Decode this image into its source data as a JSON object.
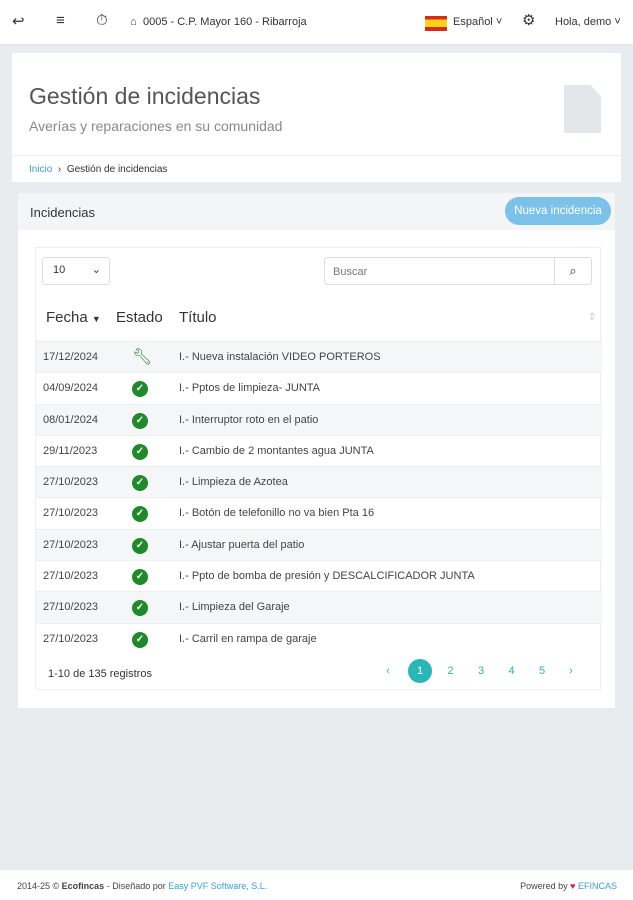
{
  "topbar": {
    "location": "0005 - C.P. Mayor 160 - Ribarroja",
    "language": "Español",
    "user": "Hola, demo"
  },
  "header": {
    "title": "Gestión de incidencias",
    "subtitle": "Averías y reparaciones en su comunidad",
    "breadcrumb": [
      "Inicio",
      "Gestión de incidencias"
    ]
  },
  "panel": {
    "title": "Incidencias",
    "new_button": "Nueva incidencia",
    "page_size": "10",
    "search_placeholder": "Buscar",
    "columns": [
      "Fecha",
      "Estado",
      "Título"
    ],
    "rows": [
      {
        "date": "17/12/2024",
        "status": "in-progress",
        "title": "I.- Nueva instalación VIDEO PORTEROS"
      },
      {
        "date": "04/09/2024",
        "status": "done",
        "title": "I.- Pptos de limpieza- JUNTA"
      },
      {
        "date": "08/01/2024",
        "status": "done",
        "title": "I.- Interruptor roto en el patio"
      },
      {
        "date": "29/11/2023",
        "status": "done",
        "title": "I.- Cambio de 2 montantes agua JUNTA"
      },
      {
        "date": "27/10/2023",
        "status": "done",
        "title": "I.- Limpieza de Azotea"
      },
      {
        "date": "27/10/2023",
        "status": "done",
        "title": "I.- Botón de telefonillo no va bien Pta 16"
      },
      {
        "date": "27/10/2023",
        "status": "done",
        "title": "I.- Ajustar puerta del patio"
      },
      {
        "date": "27/10/2023",
        "status": "done",
        "title": "I.- Ppto de bomba de presión y DESCALCIFICADOR JUNTA"
      },
      {
        "date": "27/10/2023",
        "status": "done",
        "title": "I.- Limpieza del Garaje"
      },
      {
        "date": "27/10/2023",
        "status": "done",
        "title": "I.- Carril en rampa de garaje"
      }
    ],
    "info": "1-10 de 135 registros",
    "pages": [
      "1",
      "2",
      "3",
      "4",
      "5"
    ],
    "current_page": "1"
  },
  "footer": {
    "left_prefix": "2014-25 © ",
    "brand": "Ecofincas",
    "designed": " - Diseñado por ",
    "designer": "Easy PVF Software, S.L.",
    "powered": "Powered by ",
    "powered_brand": "EFINCAS"
  }
}
